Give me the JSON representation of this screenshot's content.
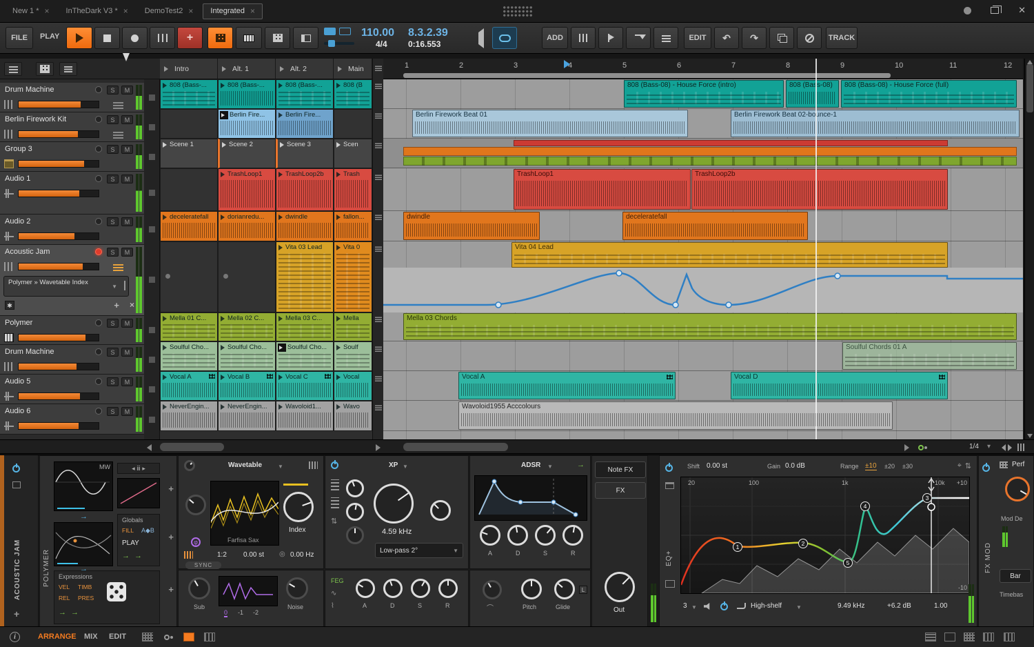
{
  "tabs": {
    "items": [
      {
        "label": "New 1 *"
      },
      {
        "label": "InTheDark V3 *"
      },
      {
        "label": "DemoTest2"
      },
      {
        "label": "Integrated"
      }
    ]
  },
  "toolbar": {
    "file": "FILE",
    "play_label": "PLAY",
    "add": "ADD",
    "edit": "EDIT",
    "track": "TRACK",
    "tempo": "110.00",
    "timesig": "4/4",
    "position": "8.3.2.39",
    "time": "0:16.553"
  },
  "labels": {
    "solo": "S",
    "mute": "M"
  },
  "scene_header": [
    "Intro",
    "Alt. 1",
    "Alt. 2",
    "Main"
  ],
  "ruler_bars": [
    "1",
    "2",
    "3",
    "4",
    "5",
    "6",
    "7",
    "8",
    "9",
    "10",
    "11",
    "12"
  ],
  "tracks": [
    {
      "name": "Drum Machine"
    },
    {
      "name": "Berlin Firework Kit"
    },
    {
      "name": "Group 3"
    },
    {
      "name": "Audio 1"
    },
    {
      "name": "Audio 2"
    },
    {
      "name": "Acoustic Jam",
      "device_chain": "Polymer » Wavetable Index"
    },
    {
      "name": "Polymer"
    },
    {
      "name": "Drum Machine"
    },
    {
      "name": "Audio 5"
    },
    {
      "name": "Audio 6"
    }
  ],
  "launcher": {
    "rows": [
      [
        "808 (Bass-...",
        "808 (Bass-...",
        "808 (Bass-...",
        "808 (B"
      ],
      [
        "",
        "Berlin Fire...",
        "Berlin Fire...",
        ""
      ],
      [
        "Scene 1",
        "Scene 2",
        "Scene 3",
        "Scen"
      ],
      [
        "",
        "TrashLoop1",
        "TrashLoop2b",
        "Trash"
      ],
      [
        "deceleratefall",
        "dorianredu...",
        "dwindle",
        "fallon..."
      ],
      [
        "",
        "",
        "Vita 03 Lead",
        "Vita 0"
      ],
      [
        "Mella 01 C...",
        "Mella 02 C...",
        "Mella 03 C...",
        "Mella"
      ],
      [
        "Soulful Cho...",
        "Soulful Cho...",
        "Soulful Cho...",
        "Soulf"
      ],
      [
        "Vocal A",
        "Vocal B",
        "Vocal C",
        "Vocal"
      ],
      [
        "NeverEngin...",
        "NeverEngin...",
        "Wavoloid1...",
        "Wavo"
      ]
    ]
  },
  "arranger": {
    "zoom": "1/4",
    "clips": {
      "c808_intro": "808 (Bass-08) - House Force (intro)",
      "c808_mid": "808 (Bass-08)",
      "c808_full": "808 (Bass-08) - House Force (full)",
      "berlin1": "Berlin Firework Beat 01",
      "berlin2": "Berlin Firework Beat 02-bounce-1",
      "trash1": "TrashLoop1",
      "trash2": "TrashLoop2b",
      "dwindle": "dwindle",
      "decel": "deceleratefall",
      "vita": "Vita 04 Lead",
      "mella": "Mella 03 Chords",
      "soulful": "Soulful Chords 01 A",
      "vocal_a": "Vocal A",
      "vocal_d": "Vocal D",
      "wavoloid": "Wavoloid1955 Acccolours"
    }
  },
  "device": {
    "track_name": "ACOUSTIC JAM",
    "device_name": "POLYMER",
    "osc": {
      "mw": "MW"
    },
    "globals": {
      "title": "Globals",
      "fill": "FILL",
      "ab": "A◆B",
      "play": "PLAY"
    },
    "expressions": {
      "title": "Expressions",
      "vel": "VEL",
      "timb": "TIMB",
      "rel": "REL",
      "pres": "PRES"
    },
    "wavetable": {
      "title": "Wavetable",
      "preset": "Farfisa Sax",
      "index_label": "Index",
      "ratio": "1:2",
      "detune": "0.00 st",
      "freq": "0.00 Hz",
      "sync": "SYNC"
    },
    "filter": {
      "title": "XP",
      "cutoff": "4.59 kHz",
      "mode": "Low-pass 2°",
      "feg": "FEG"
    },
    "env": {
      "title": "ADSR",
      "a": "A",
      "d": "D",
      "s": "S",
      "r": "R"
    },
    "fx_tabs": {
      "note_fx": "Note FX",
      "fx": "FX"
    },
    "osc2": {
      "sub": "Sub",
      "v0": "0",
      "v1": "-1",
      "v2": "-2",
      "noise": "Noise"
    },
    "amp": {
      "pitch": "Pitch",
      "glide": "Glide",
      "glide_mode": "L",
      "out": "Out"
    },
    "eq": {
      "label": "EQ+",
      "shift_label": "Shift",
      "shift": "0.00 st",
      "gain_label": "Gain",
      "gain": "0.0 dB",
      "range_label": "Range",
      "range10": "±10",
      "range20": "±20",
      "range30": "±30",
      "f1": "20",
      "f2": "100",
      "f3": "1k",
      "f4": "10k",
      "db_hi": "+10",
      "db_lo": "-10",
      "nodes": [
        "1",
        "2",
        "3",
        "4",
        "5"
      ],
      "band": "3",
      "band_type": "High-shelf",
      "band_freq": "9.49 kHz",
      "band_gain": "+6.2 dB",
      "band_q": "1.00"
    },
    "fxmod": {
      "label": "FX MOD",
      "perf": "Perf",
      "mod_dep": "Mod De",
      "bar": "Bar",
      "timebase": "Timebas"
    }
  },
  "statusbar": {
    "info": "i",
    "arrange": "ARRANGE",
    "mix": "MIX",
    "edit": "EDIT"
  }
}
